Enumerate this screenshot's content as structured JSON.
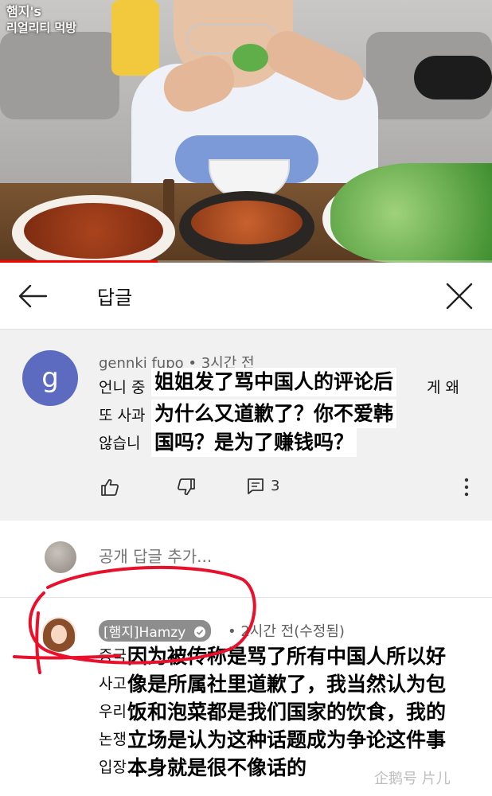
{
  "video": {
    "channel_watermark_line1": "햄지's",
    "channel_watermark_line2": "리얼리티 먹방",
    "progress_fraction": 0.32
  },
  "header": {
    "title": "답글",
    "back_icon": "arrow-left-icon",
    "close_icon": "close-x-icon"
  },
  "parent_comment": {
    "avatar_letter": "g",
    "avatar_color": "#5c6bc0",
    "author": "gennki fupo",
    "time": "3시간 전",
    "meta": "gennki fupo • 3시간 전",
    "text_lines": [
      "언니 중",
      "또 사과",
      "않습니"
    ],
    "text_right": "게 왜",
    "overlay_lines": [
      "姐姐发了骂中国人的评论后",
      "为什么又道歉了？你不爱韩",
      "国吗？是为了赚钱吗？"
    ],
    "reply_count": "3",
    "icons": [
      "thumbs-up-icon",
      "thumbs-down-icon",
      "reply-icon",
      "more-vert-icon"
    ]
  },
  "add_reply": {
    "placeholder": "공개 답글 추가..."
  },
  "reply": {
    "author_badge": "[햄지]Hamzy",
    "meta": "• 2시간 전(수정됨)",
    "left_fragments": [
      "중국",
      "사고",
      "우리",
      "논쟁",
      "입장"
    ],
    "overlay_lines": [
      "因为被传称是骂了所有中国人所以好",
      "像是所属社里道歉了，我当然认为包",
      "饭和泡菜都是我们国家的饮食，我的",
      "立场是认为这种话题成为争论这件事",
      "本身就是很不像话的"
    ]
  },
  "colors": {
    "accent_red": "#ff0000",
    "annotation_red": "#e8102a",
    "parent_bg": "#f1f1f1"
  },
  "site_watermark": "企鹅号 片儿"
}
